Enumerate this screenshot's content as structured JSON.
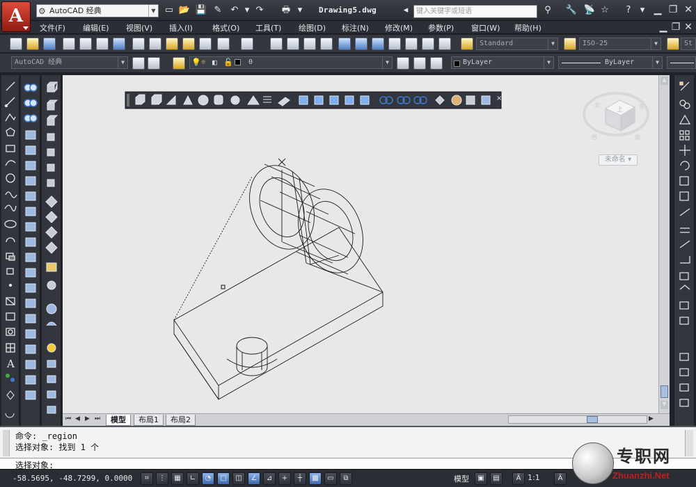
{
  "titlebar": {
    "app_button_glyph": "A",
    "workspace": "AutoCAD 经典",
    "document_title": "Drawing5.dwg",
    "search_placeholder": "键入关键字或短语"
  },
  "menus": [
    "文件(F)",
    "编辑(E)",
    "视图(V)",
    "插入(I)",
    "格式(O)",
    "工具(T)",
    "绘图(D)",
    "标注(N)",
    "修改(M)",
    "参数(P)",
    "窗口(W)",
    "帮助(H)"
  ],
  "toolbar": {
    "text_style": "Standard",
    "dim_style": "ISO-25",
    "partial_style": "St"
  },
  "properties_bar": {
    "workspace_combo": "AutoCAD 经典",
    "layer": "0",
    "color": "ByLayer",
    "linetype": "ByLayer"
  },
  "viewcube": {
    "face_top": "上",
    "compass_n": "北",
    "compass_e": "东",
    "compass_s": "南",
    "compass_w": "西",
    "ucs_label": "未命名"
  },
  "tabs": [
    "模型",
    "布局1",
    "布局2"
  ],
  "command_line": {
    "line1": "命令:  _region",
    "line2": "选择对象: 找到 1 个",
    "prompt": "选择对象:"
  },
  "status": {
    "coordinates": "-58.5695,  -48.7299, 0.0000",
    "model_label": "模型",
    "scale": "1:1"
  },
  "watermark": {
    "main": "专职网",
    "sub": "Zhuanzhi.Net"
  },
  "colors": {
    "canvas": "#e8e8e8",
    "chrome": "#33363d",
    "accent_red": "#c62a1e"
  }
}
